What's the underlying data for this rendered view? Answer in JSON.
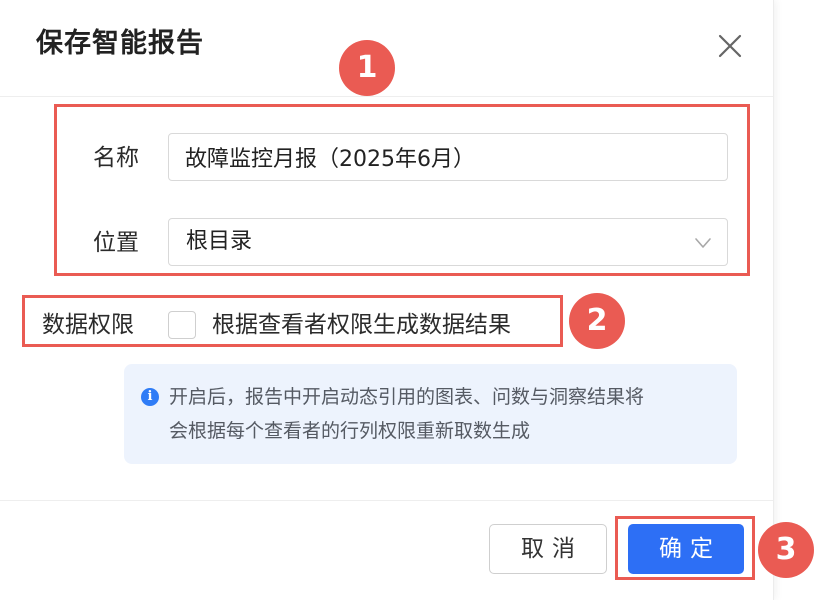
{
  "dialog": {
    "title": "保存智能报告"
  },
  "form": {
    "name_label": "名称",
    "name_value": "故障监控月报（2025年6月）",
    "location_label": "位置",
    "location_value": "根目录",
    "permission_label": "数据权限",
    "permission_checkbox_label": "根据查看者权限生成数据结果",
    "permission_checked": false
  },
  "info": {
    "icon": "info-icon",
    "line1": "开启后，报告中开启动态引用的图表、问数与洞察结果将",
    "line2": "会根据每个查看者的行列权限重新取数生成"
  },
  "footer": {
    "cancel_label": "取消",
    "confirm_label": "确定"
  },
  "annotations": {
    "badge1": "1",
    "badge2": "2",
    "badge3": "3"
  },
  "colors": {
    "annotation": "#ea5b53",
    "primary": "#2d6ff5",
    "info_bg": "#edf3fd"
  }
}
